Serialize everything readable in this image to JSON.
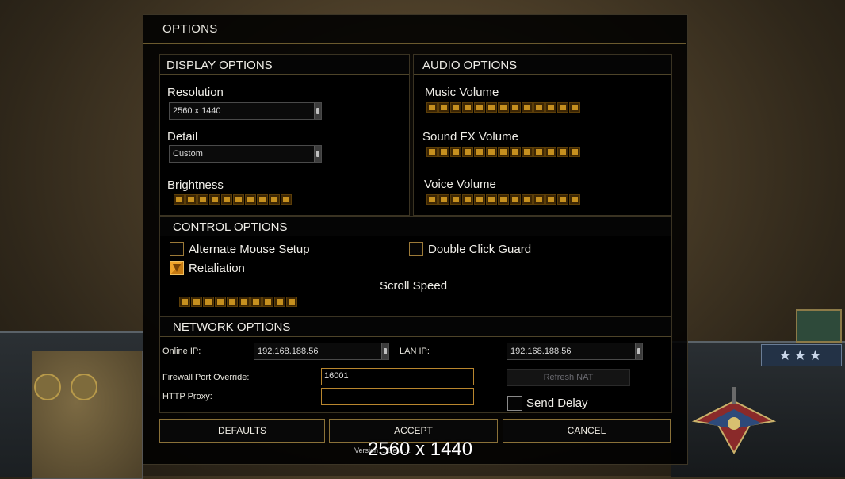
{
  "window": {
    "title": "OPTIONS"
  },
  "display": {
    "heading": "DISPLAY OPTIONS",
    "resolution_label": "Resolution",
    "resolution_value": "2560 x 1440",
    "detail_label": "Detail",
    "detail_value": "Custom",
    "brightness_label": "Brightness",
    "brightness_level": 10,
    "brightness_max": 10
  },
  "audio": {
    "heading": "AUDIO OPTIONS",
    "music_label": "Music Volume",
    "music_level": 13,
    "sfx_label": "Sound FX Volume",
    "sfx_level": 13,
    "voice_label": "Voice Volume",
    "voice_level": 13,
    "max": 13
  },
  "control": {
    "heading": "CONTROL OPTIONS",
    "alt_mouse_label": "Alternate Mouse Setup",
    "alt_mouse_checked": false,
    "double_click_label": "Double Click Guard",
    "double_click_checked": false,
    "retaliation_label": "Retaliation",
    "retaliation_checked": true,
    "scroll_speed_label": "Scroll Speed",
    "scroll_speed_level": 10,
    "scroll_speed_max": 10
  },
  "network": {
    "heading": "NETWORK OPTIONS",
    "online_ip_label": "Online IP:",
    "online_ip_value": "192.168.188.56",
    "lan_ip_label": "LAN IP:",
    "lan_ip_value": "192.168.188.56",
    "firewall_label": "Firewall Port Override:",
    "firewall_value": "16001",
    "proxy_label": "HTTP Proxy:",
    "proxy_value": "",
    "refresh_nat_label": "Refresh NAT",
    "send_delay_label": "Send Delay",
    "send_delay_checked": false
  },
  "buttons": {
    "defaults": "DEFAULTS",
    "accept": "ACCEPT",
    "cancel": "CANCEL"
  },
  "footer": {
    "version_text": "Version ... Beta ...",
    "resolution_overlay": "2560 x 1440"
  },
  "colors": {
    "accent_gold": "#c6901f",
    "panel_bg": "#000000",
    "border_gold": "#8a7138"
  },
  "hud": {
    "rank_stars": "★★★"
  }
}
